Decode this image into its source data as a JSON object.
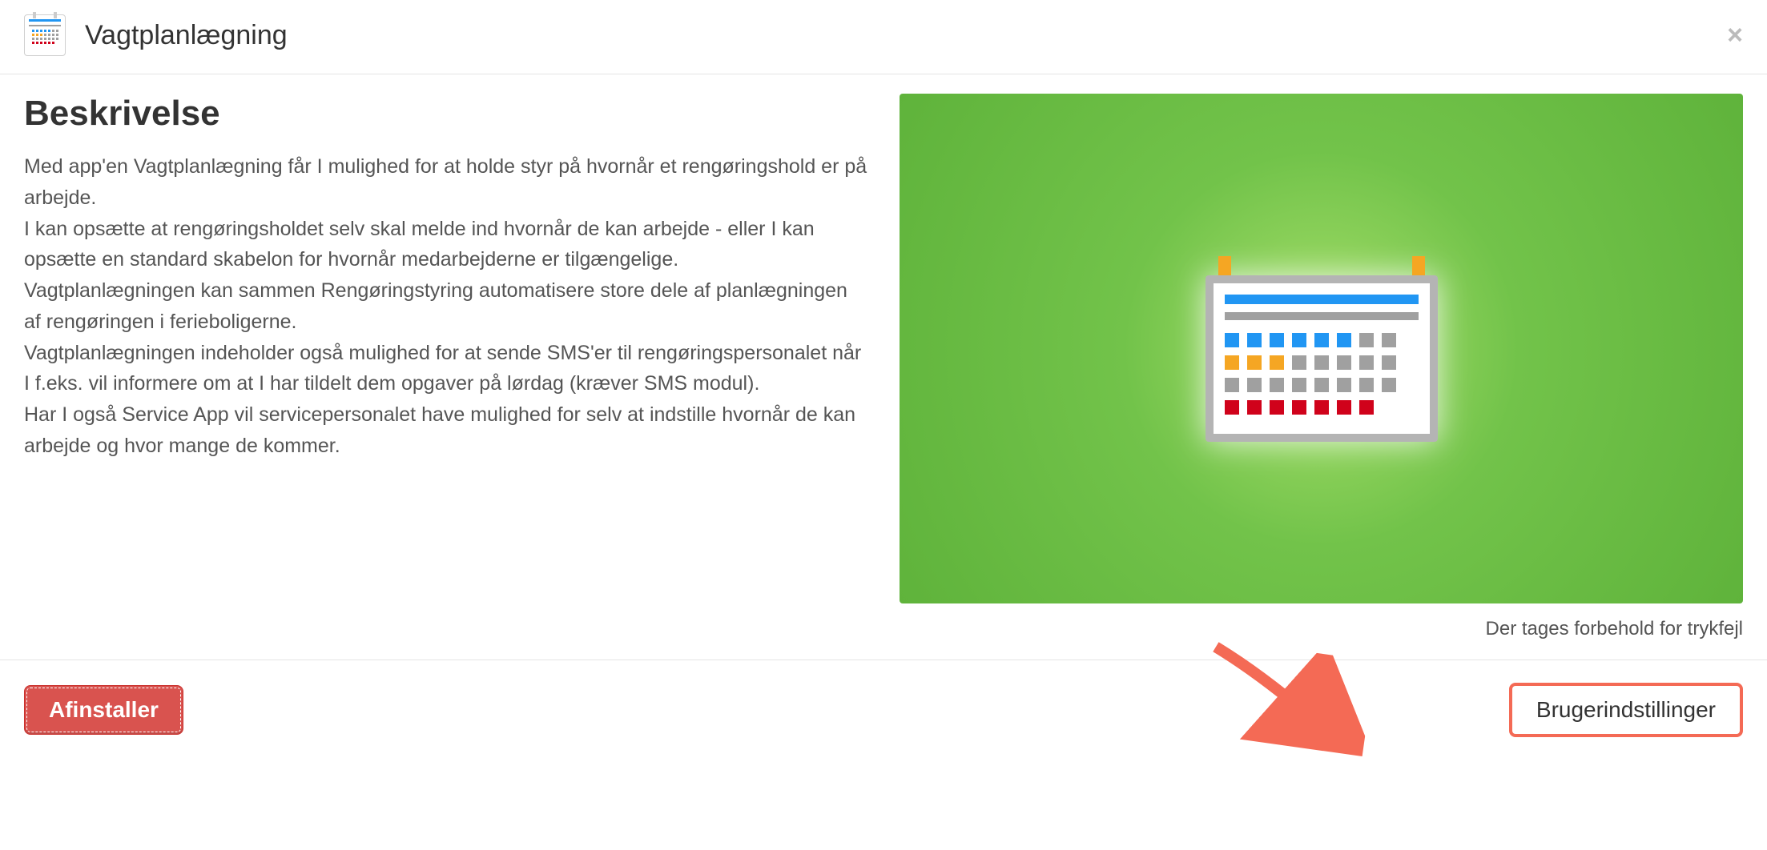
{
  "header": {
    "title": "Vagtplanlægning"
  },
  "description": {
    "heading": "Beskrivelse",
    "body": "Med app'en Vagtplanlægning får I mulighed for at holde styr på hvornår et rengøringshold er på arbejde.\nI kan opsætte at rengøringsholdet selv skal melde ind hvornår de kan arbejde - eller I kan opsætte en standard skabelon for hvornår medarbejderne er tilgængelige.\nVagtplanlægningen kan sammen Rengøringstyring automatisere store dele af planlægningen af rengøringen i ferieboligerne.\nVagtplanlægningen indeholder også mulighed for at sende SMS'er til rengøringspersonalet når I f.eks. vil informere om at I har tildelt dem opgaver på lørdag (kræver SMS modul).\nHar I også Service App vil servicepersonalet have mulighed for selv at indstille hvornår de kan arbejde og hvor mange de kommer."
  },
  "disclaimer": "Der tages forbehold for trykfejl",
  "footer": {
    "uninstall": "Afinstaller",
    "user_settings": "Brugerindstillinger"
  },
  "colors": {
    "accent_red": "#d9534f",
    "highlight": "#f46a55",
    "green_bg": "#5fb33b"
  }
}
